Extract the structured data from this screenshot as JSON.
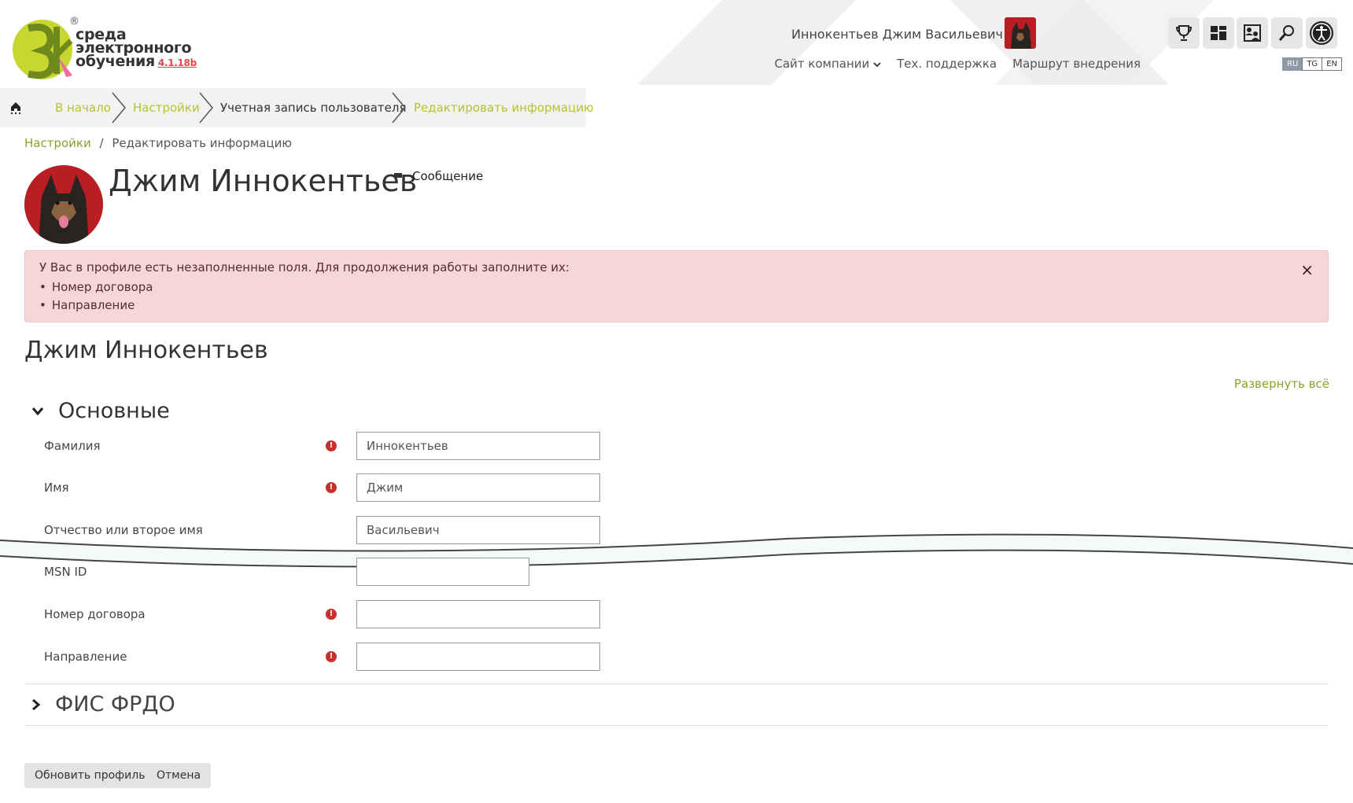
{
  "header": {
    "logo": {
      "line1": "среда",
      "line2": "электронного",
      "line3": "обучения",
      "version": "4.1.18b",
      "reg": "®"
    },
    "user_full_name": "Иннокентьев Джим Васильевич",
    "nav": {
      "company_site": "Сайт компании",
      "support": "Тех. поддержка",
      "route": "Маршрут внедрения"
    },
    "languages": [
      "RU",
      "TG",
      "EN"
    ],
    "active_language": "RU",
    "tool_icons": [
      "trophy-icon",
      "dashboard-icon",
      "user-switch-icon",
      "search-icon",
      "accessibility-icon"
    ]
  },
  "breadcrumb": {
    "items": [
      "В начало",
      "Настройки",
      "Учетная запись пользователя",
      "Редактировать информацию"
    ]
  },
  "sub_breadcrumb": {
    "link": "Настройки",
    "separator": "/",
    "current": "Редактировать информацию"
  },
  "profile": {
    "name": "Джим Иннокентьев",
    "message_label": "Сообщение"
  },
  "alert": {
    "text": "У Вас в профиле есть незаполненные поля. Для продолжения работы заполните их:",
    "items": [
      "Номер договора",
      "Направление"
    ],
    "close": "×"
  },
  "form": {
    "title": "Джим Иннокентьев",
    "expand_all": "Развернуть всё",
    "section_main": "Основные",
    "section_fis": "ФИС ФРДО",
    "fields": [
      {
        "label": "Фамилия",
        "value": "Иннокентьев",
        "required": true
      },
      {
        "label": "Имя",
        "value": "Джим",
        "required": true
      },
      {
        "label": "Отчество или второе имя",
        "value": "Васильевич",
        "required": false
      },
      {
        "label": "MSN ID",
        "value": "",
        "required": false
      },
      {
        "label": "Номер договора",
        "value": "",
        "required": true
      },
      {
        "label": "Направление",
        "value": "",
        "required": true
      }
    ],
    "update_button": "Обновить профиль",
    "cancel_button": "Отмена"
  },
  "colors": {
    "accent_green": "#8aa12c",
    "alert_bg": "#f6d6d8",
    "required_red": "#c9302c"
  }
}
